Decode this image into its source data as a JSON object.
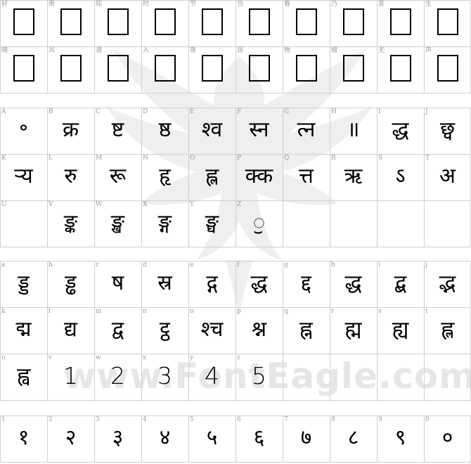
{
  "sections": [
    {
      "rows": [
        {
          "cells": [
            {
              "key": "好",
              "tofu": true
            },
            {
              "key": "雨",
              "tofu": true
            },
            {
              "key": "知",
              "tofu": true
            },
            {
              "key": "时",
              "tofu": true
            },
            {
              "key": "节",
              "tofu": true
            },
            {
              "key": "当",
              "tofu": true
            },
            {
              "key": "春",
              "tofu": true
            },
            {
              "key": "乃",
              "tofu": true
            },
            {
              "key": "发",
              "tofu": true
            },
            {
              "key": "生",
              "tofu": true
            }
          ]
        },
        {
          "cells": [
            {
              "key": "随",
              "tofu": true
            },
            {
              "key": "风",
              "tofu": true
            },
            {
              "key": "潜",
              "tofu": true
            },
            {
              "key": "入",
              "tofu": true
            },
            {
              "key": "夜",
              "tofu": true
            },
            {
              "key": "润",
              "tofu": true
            },
            {
              "key": "物",
              "tofu": true
            },
            {
              "key": "细",
              "tofu": true
            },
            {
              "key": "无",
              "tofu": true
            },
            {
              "key": "声",
              "tofu": true
            }
          ]
        }
      ]
    },
    {
      "rows": [
        {
          "cells": [
            {
              "key": "A",
              "glyph": "॰"
            },
            {
              "key": "B",
              "glyph": "क्र"
            },
            {
              "key": "C",
              "glyph": "ष्ट"
            },
            {
              "key": "D",
              "glyph": "ष्ठ"
            },
            {
              "key": "E",
              "glyph": "श्व"
            },
            {
              "key": "F",
              "glyph": "स्न"
            },
            {
              "key": "G",
              "glyph": "त्न"
            },
            {
              "key": "H",
              "glyph": "॥"
            },
            {
              "key": "I",
              "glyph": "द्ध"
            },
            {
              "key": "J",
              "glyph": "छ्व"
            }
          ]
        },
        {
          "cells": [
            {
              "key": "K",
              "glyph": "ऱ्य"
            },
            {
              "key": "L",
              "glyph": "रु"
            },
            {
              "key": "M",
              "glyph": "रू"
            },
            {
              "key": "N",
              "glyph": "हृ"
            },
            {
              "key": "O",
              "glyph": "ह्ल"
            },
            {
              "key": "P",
              "glyph": "क्क"
            },
            {
              "key": "Q",
              "glyph": "त्त"
            },
            {
              "key": "R",
              "glyph": "ऋ"
            },
            {
              "key": "S",
              "glyph": "ऽ"
            },
            {
              "key": "T",
              "glyph": "अ"
            }
          ]
        },
        {
          "cells": [
            {
              "key": "U",
              "glyph": ""
            },
            {
              "key": "V",
              "glyph": "ङ्क"
            },
            {
              "key": "W",
              "glyph": "ङ्ख"
            },
            {
              "key": "X",
              "glyph": "ङ्ग"
            },
            {
              "key": "Y",
              "glyph": "ङ्घ"
            },
            {
              "key": "Z",
              "glyph": "ॖ"
            },
            {
              "key": "",
              "glyph": ""
            },
            {
              "key": "",
              "glyph": ""
            },
            {
              "key": "",
              "glyph": ""
            },
            {
              "key": "",
              "glyph": ""
            }
          ]
        }
      ]
    },
    {
      "rows": [
        {
          "cells": [
            {
              "key": "a",
              "glyph": "ड्ड"
            },
            {
              "key": "b",
              "glyph": "ड्ढ"
            },
            {
              "key": "c",
              "glyph": "ष"
            },
            {
              "key": "d",
              "glyph": "स्र"
            },
            {
              "key": "e",
              "glyph": "द्ग"
            },
            {
              "key": "f",
              "glyph": "द्ध"
            },
            {
              "key": "g",
              "glyph": "द्द"
            },
            {
              "key": "h",
              "glyph": "द्ध"
            },
            {
              "key": "i",
              "glyph": "द्ब"
            },
            {
              "key": "j",
              "glyph": "द्भ"
            }
          ]
        },
        {
          "cells": [
            {
              "key": "k",
              "glyph": "द्म"
            },
            {
              "key": "l",
              "glyph": "द्य"
            },
            {
              "key": "m",
              "glyph": "द्व"
            },
            {
              "key": "n",
              "glyph": "ट्ठ"
            },
            {
              "key": "o",
              "glyph": "श्च"
            },
            {
              "key": "p",
              "glyph": "श्न"
            },
            {
              "key": "q",
              "glyph": "ह्न"
            },
            {
              "key": "r",
              "glyph": "ह्म"
            },
            {
              "key": "s",
              "glyph": "ह्य"
            },
            {
              "key": "t",
              "glyph": "ह्ल"
            }
          ]
        },
        {
          "cells": [
            {
              "key": "u",
              "glyph": "ह्व"
            },
            {
              "key": "v",
              "glyph": "1",
              "latin": true
            },
            {
              "key": "w",
              "glyph": "2",
              "latin": true
            },
            {
              "key": "x",
              "glyph": "3",
              "latin": true
            },
            {
              "key": "y",
              "glyph": "4",
              "latin": true
            },
            {
              "key": "z",
              "glyph": "5",
              "latin": true
            },
            {
              "key": "",
              "glyph": ""
            },
            {
              "key": "",
              "glyph": ""
            },
            {
              "key": "",
              "glyph": ""
            },
            {
              "key": "",
              "glyph": ""
            }
          ]
        }
      ]
    },
    {
      "rows": [
        {
          "cells": [
            {
              "key": "1",
              "glyph": "१"
            },
            {
              "key": "2",
              "glyph": "२"
            },
            {
              "key": "3",
              "glyph": "३"
            },
            {
              "key": "4",
              "glyph": "४"
            },
            {
              "key": "5",
              "glyph": "५"
            },
            {
              "key": "6",
              "glyph": "६"
            },
            {
              "key": "7",
              "glyph": "७"
            },
            {
              "key": "8",
              "glyph": "८"
            },
            {
              "key": "9",
              "glyph": "९"
            },
            {
              "key": "0",
              "glyph": "०"
            }
          ]
        }
      ]
    }
  ],
  "watermark": {
    "text": "www.FontEagle.com",
    "icon": "eagle-icon"
  }
}
